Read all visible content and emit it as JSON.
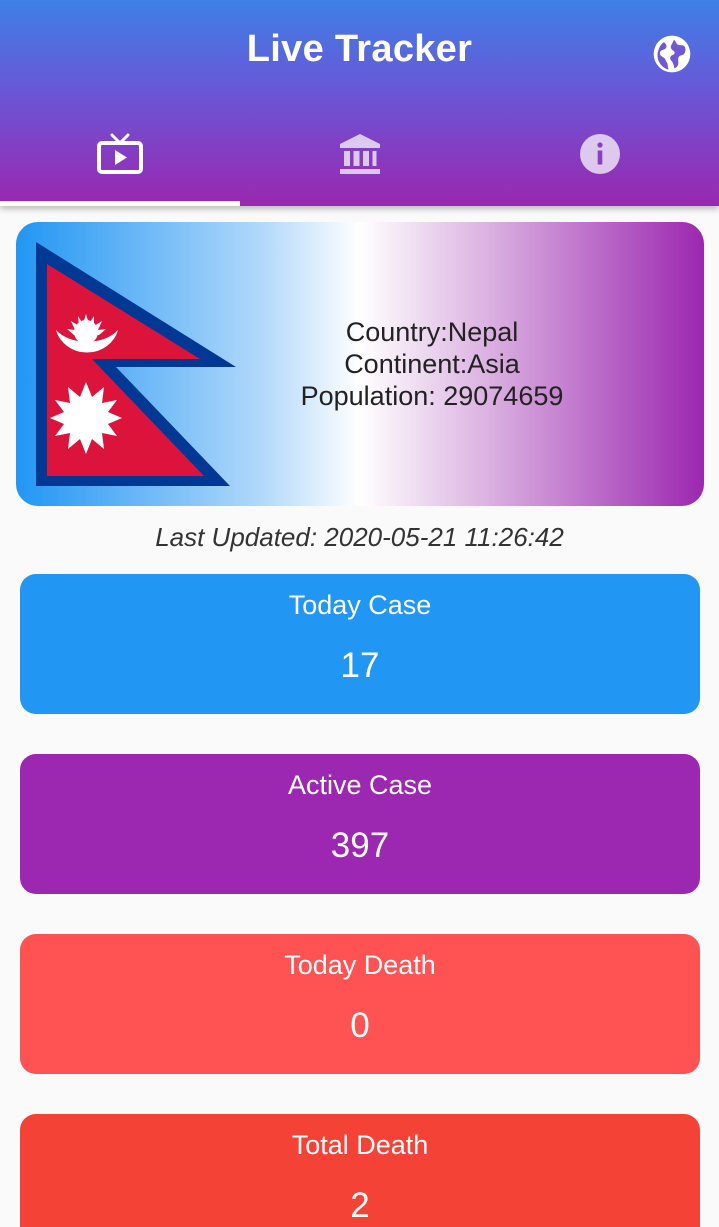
{
  "app": {
    "title": "Live Tracker"
  },
  "tabs": [
    {
      "icon": "tv-icon",
      "active": true
    },
    {
      "icon": "bank-icon",
      "active": false
    },
    {
      "icon": "info-icon",
      "active": false
    }
  ],
  "country": {
    "line1": "Country:Nepal",
    "line2": "Continent:Asia",
    "line3": "Population: 29074659",
    "flag_icon": "nepal-flag"
  },
  "last_updated": "Last Updated: 2020-05-21 11:26:42",
  "stats": [
    {
      "label": "Today Case",
      "value": "17",
      "color": "#2196f3"
    },
    {
      "label": "Active Case",
      "value": "397",
      "color": "#9c27b0"
    },
    {
      "label": "Today Death",
      "value": "0",
      "color": "#ff5252"
    },
    {
      "label": "Total Death",
      "value": "2",
      "color": "#f44336"
    }
  ],
  "colors": {
    "appbar_top": "#3d80e6",
    "appbar_bottom": "#9b27b0",
    "flag_red": "#dc143c",
    "flag_blue": "#003893"
  }
}
